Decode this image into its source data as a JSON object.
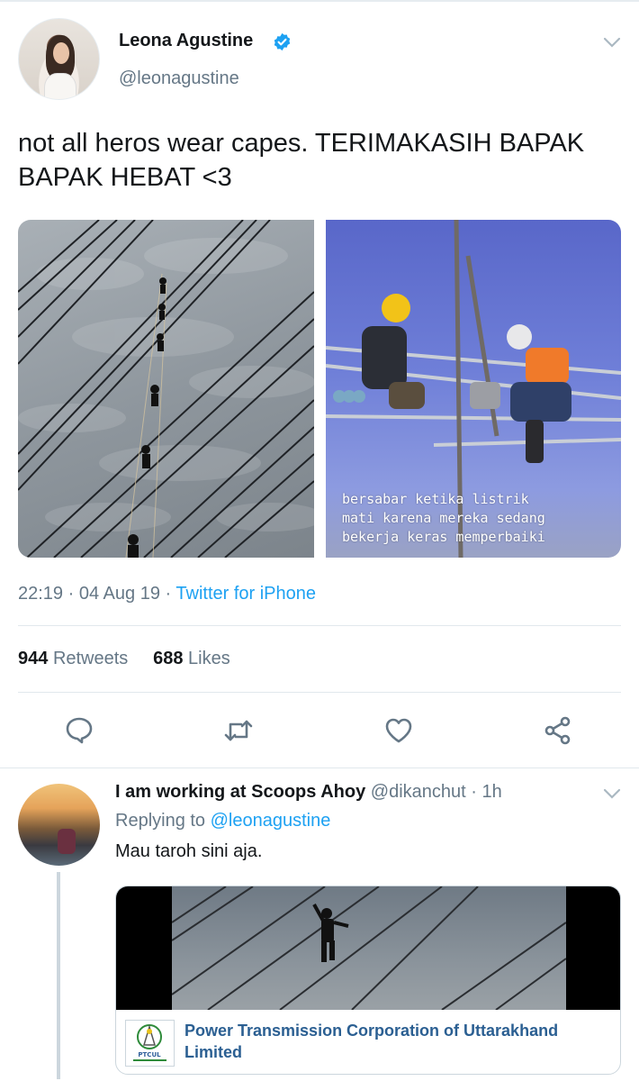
{
  "tweet": {
    "author_name": "Leona Agustine",
    "author_handle": "@leonagustine",
    "text": "not all heros wear capes. TERIMAKASIH BAPAK BAPAK HEBAT <3",
    "image_caption": "bersabar ketika listrik\nmati karena mereka sedang\nbekerja keras memperbaiki",
    "time": "22:19",
    "separator": "·",
    "date": "04 Aug 19",
    "source": "Twitter for iPhone",
    "retweets_count": "944",
    "retweets_label": "Retweets",
    "likes_count": "688",
    "likes_label": "Likes"
  },
  "actions": {
    "reply_icon": "reply-icon",
    "retweet_icon": "retweet-icon",
    "like_icon": "heart-icon",
    "share_icon": "share-icon"
  },
  "reply": {
    "author_name": "I am working at Scoops Ahoy",
    "author_handle": "@dikanchut",
    "separator": "·",
    "time_ago": "1h",
    "replying_label": "Replying to",
    "replying_to": "@leonagustine",
    "text": "Mau taroh sini aja.",
    "card_title": "Power Transmission Corporation of Uttarakhand Limited",
    "card_logo_text": "PTCUL"
  },
  "colors": {
    "accent": "#1da1f2",
    "muted": "#657786",
    "text": "#14171a",
    "card_link": "#2b5f92"
  }
}
